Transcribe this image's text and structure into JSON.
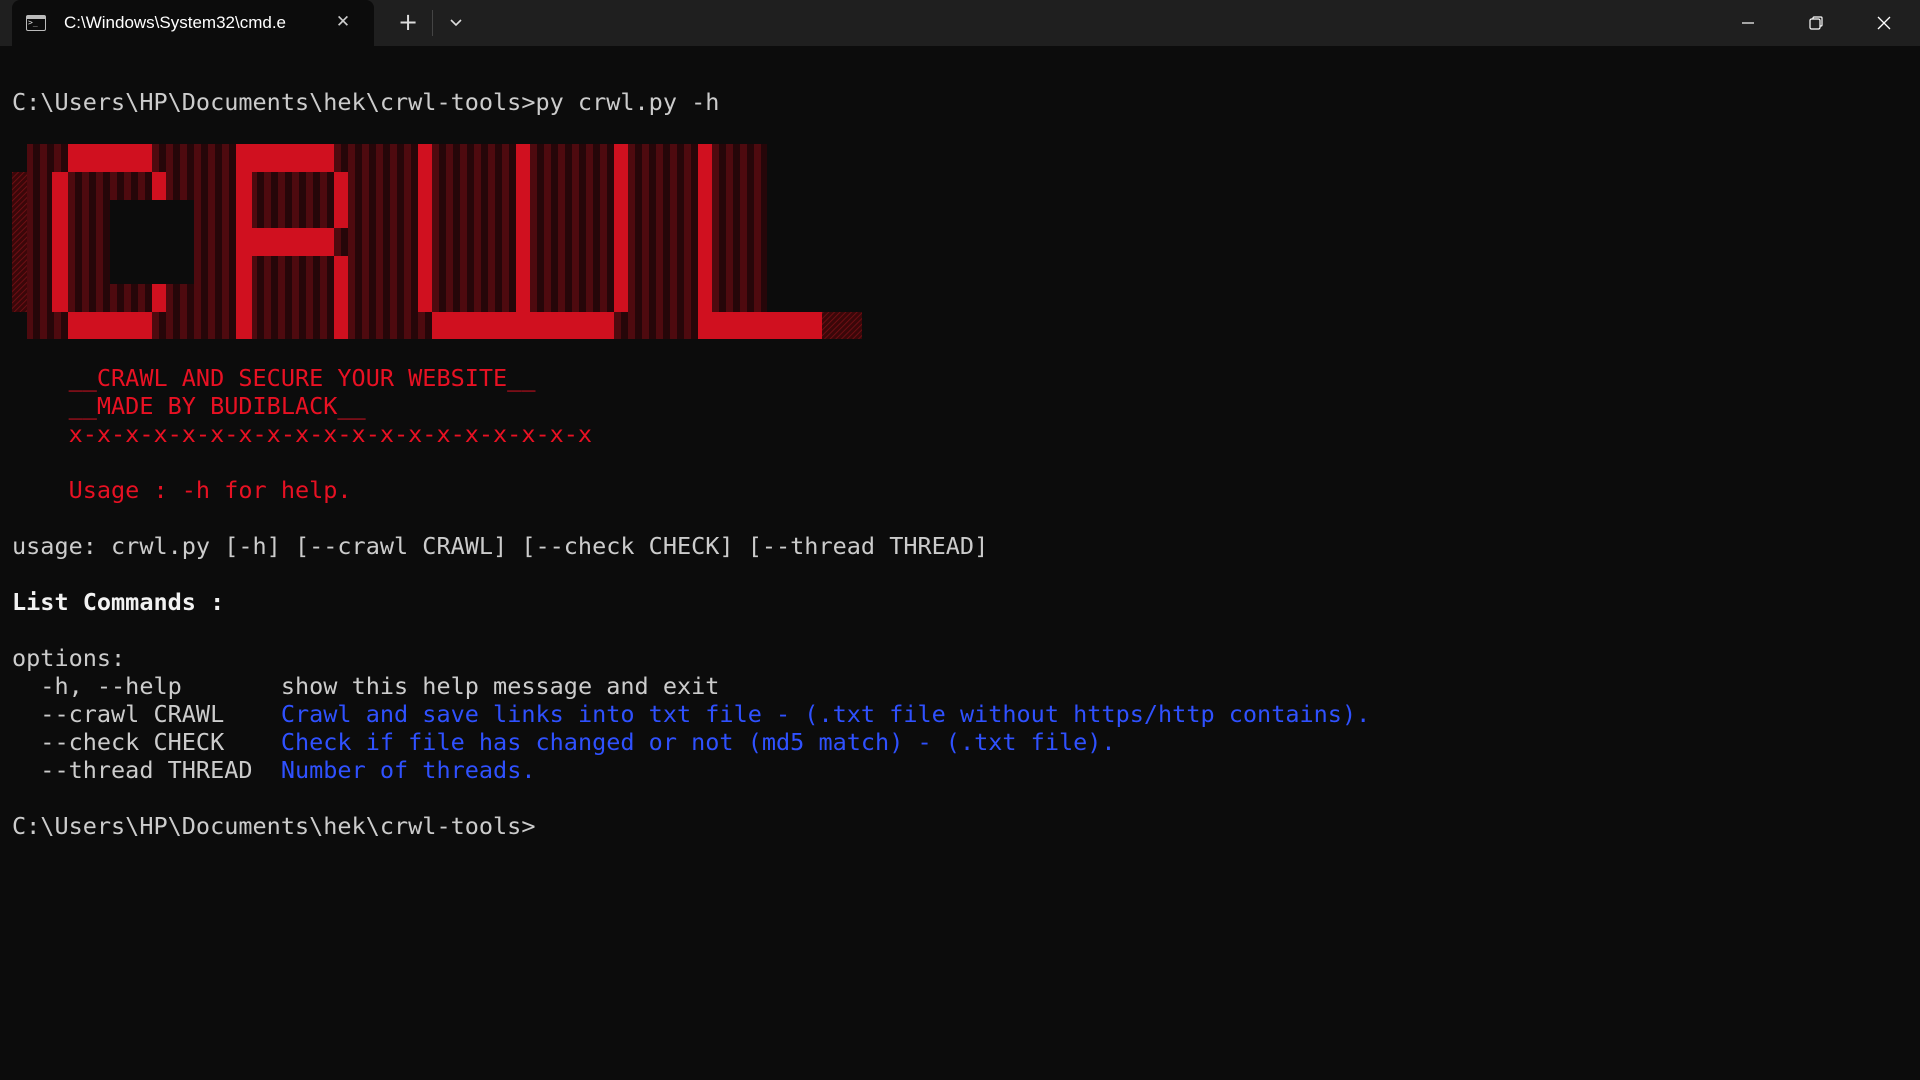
{
  "window": {
    "tab_title": "C:\\Windows\\System32\\cmd.e",
    "tab_icon": "terminal-icon",
    "new_tab_label": "+",
    "close_tab_label": "✕"
  },
  "colors": {
    "background": "#0c0c0c",
    "titlebar": "#1f1f1f",
    "text": "#cccccc",
    "red": "#e81123",
    "blue": "#2f51ff"
  },
  "terminal": {
    "prompt_command": "C:\\Users\\HP\\Documents\\hek\\crwl-tools>py crwl.py -h",
    "ascii_art_text": "CRWL",
    "banner_line_1": "    __CRAWL AND SECURE YOUR WEBSITE__",
    "banner_line_2": "    __MADE BY BUDIBLACK__",
    "banner_line_3": "    x-x-x-x-x-x-x-x-x-x-x-x-x-x-x-x-x-x-x",
    "banner_usage": "    Usage : -h for help.",
    "usage_line": "usage: crwl.py [-h] [--crawl CRAWL] [--check CHECK] [--thread THREAD]",
    "list_commands": "List Commands :",
    "options_header": "options:",
    "options": [
      {
        "flag": "  -h, --help       ",
        "desc": "show this help message and exit"
      },
      {
        "flag": "  --crawl CRAWL    ",
        "desc": "Crawl and save links into txt file - (.txt file without https/http contains)."
      },
      {
        "flag": "  --check CHECK    ",
        "desc": "Check if file has changed or not (md5 match) - (.txt file)."
      },
      {
        "flag": "  --thread THREAD  ",
        "desc": "Number of threads."
      }
    ],
    "final_prompt": "C:\\Users\\HP\\Documents\\hek\\crwl-tools>"
  }
}
